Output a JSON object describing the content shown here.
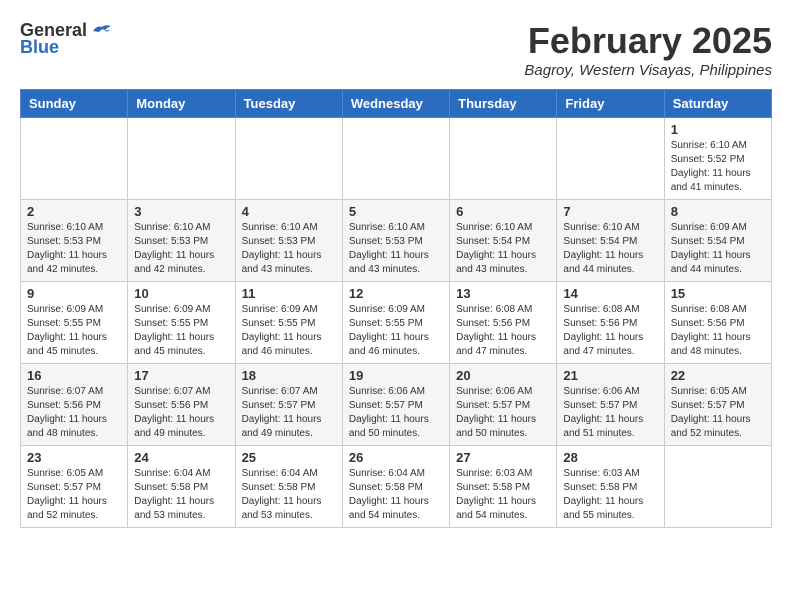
{
  "header": {
    "logo_general": "General",
    "logo_blue": "Blue",
    "month_year": "February 2025",
    "location": "Bagroy, Western Visayas, Philippines"
  },
  "weekdays": [
    "Sunday",
    "Monday",
    "Tuesday",
    "Wednesday",
    "Thursday",
    "Friday",
    "Saturday"
  ],
  "weeks": [
    [
      {
        "day": "",
        "info": ""
      },
      {
        "day": "",
        "info": ""
      },
      {
        "day": "",
        "info": ""
      },
      {
        "day": "",
        "info": ""
      },
      {
        "day": "",
        "info": ""
      },
      {
        "day": "",
        "info": ""
      },
      {
        "day": "1",
        "info": "Sunrise: 6:10 AM\nSunset: 5:52 PM\nDaylight: 11 hours\nand 41 minutes."
      }
    ],
    [
      {
        "day": "2",
        "info": "Sunrise: 6:10 AM\nSunset: 5:53 PM\nDaylight: 11 hours\nand 42 minutes."
      },
      {
        "day": "3",
        "info": "Sunrise: 6:10 AM\nSunset: 5:53 PM\nDaylight: 11 hours\nand 42 minutes."
      },
      {
        "day": "4",
        "info": "Sunrise: 6:10 AM\nSunset: 5:53 PM\nDaylight: 11 hours\nand 43 minutes."
      },
      {
        "day": "5",
        "info": "Sunrise: 6:10 AM\nSunset: 5:53 PM\nDaylight: 11 hours\nand 43 minutes."
      },
      {
        "day": "6",
        "info": "Sunrise: 6:10 AM\nSunset: 5:54 PM\nDaylight: 11 hours\nand 43 minutes."
      },
      {
        "day": "7",
        "info": "Sunrise: 6:10 AM\nSunset: 5:54 PM\nDaylight: 11 hours\nand 44 minutes."
      },
      {
        "day": "8",
        "info": "Sunrise: 6:09 AM\nSunset: 5:54 PM\nDaylight: 11 hours\nand 44 minutes."
      }
    ],
    [
      {
        "day": "9",
        "info": "Sunrise: 6:09 AM\nSunset: 5:55 PM\nDaylight: 11 hours\nand 45 minutes."
      },
      {
        "day": "10",
        "info": "Sunrise: 6:09 AM\nSunset: 5:55 PM\nDaylight: 11 hours\nand 45 minutes."
      },
      {
        "day": "11",
        "info": "Sunrise: 6:09 AM\nSunset: 5:55 PM\nDaylight: 11 hours\nand 46 minutes."
      },
      {
        "day": "12",
        "info": "Sunrise: 6:09 AM\nSunset: 5:55 PM\nDaylight: 11 hours\nand 46 minutes."
      },
      {
        "day": "13",
        "info": "Sunrise: 6:08 AM\nSunset: 5:56 PM\nDaylight: 11 hours\nand 47 minutes."
      },
      {
        "day": "14",
        "info": "Sunrise: 6:08 AM\nSunset: 5:56 PM\nDaylight: 11 hours\nand 47 minutes."
      },
      {
        "day": "15",
        "info": "Sunrise: 6:08 AM\nSunset: 5:56 PM\nDaylight: 11 hours\nand 48 minutes."
      }
    ],
    [
      {
        "day": "16",
        "info": "Sunrise: 6:07 AM\nSunset: 5:56 PM\nDaylight: 11 hours\nand 48 minutes."
      },
      {
        "day": "17",
        "info": "Sunrise: 6:07 AM\nSunset: 5:56 PM\nDaylight: 11 hours\nand 49 minutes."
      },
      {
        "day": "18",
        "info": "Sunrise: 6:07 AM\nSunset: 5:57 PM\nDaylight: 11 hours\nand 49 minutes."
      },
      {
        "day": "19",
        "info": "Sunrise: 6:06 AM\nSunset: 5:57 PM\nDaylight: 11 hours\nand 50 minutes."
      },
      {
        "day": "20",
        "info": "Sunrise: 6:06 AM\nSunset: 5:57 PM\nDaylight: 11 hours\nand 50 minutes."
      },
      {
        "day": "21",
        "info": "Sunrise: 6:06 AM\nSunset: 5:57 PM\nDaylight: 11 hours\nand 51 minutes."
      },
      {
        "day": "22",
        "info": "Sunrise: 6:05 AM\nSunset: 5:57 PM\nDaylight: 11 hours\nand 52 minutes."
      }
    ],
    [
      {
        "day": "23",
        "info": "Sunrise: 6:05 AM\nSunset: 5:57 PM\nDaylight: 11 hours\nand 52 minutes."
      },
      {
        "day": "24",
        "info": "Sunrise: 6:04 AM\nSunset: 5:58 PM\nDaylight: 11 hours\nand 53 minutes."
      },
      {
        "day": "25",
        "info": "Sunrise: 6:04 AM\nSunset: 5:58 PM\nDaylight: 11 hours\nand 53 minutes."
      },
      {
        "day": "26",
        "info": "Sunrise: 6:04 AM\nSunset: 5:58 PM\nDaylight: 11 hours\nand 54 minutes."
      },
      {
        "day": "27",
        "info": "Sunrise: 6:03 AM\nSunset: 5:58 PM\nDaylight: 11 hours\nand 54 minutes."
      },
      {
        "day": "28",
        "info": "Sunrise: 6:03 AM\nSunset: 5:58 PM\nDaylight: 11 hours\nand 55 minutes."
      },
      {
        "day": "",
        "info": ""
      }
    ]
  ]
}
